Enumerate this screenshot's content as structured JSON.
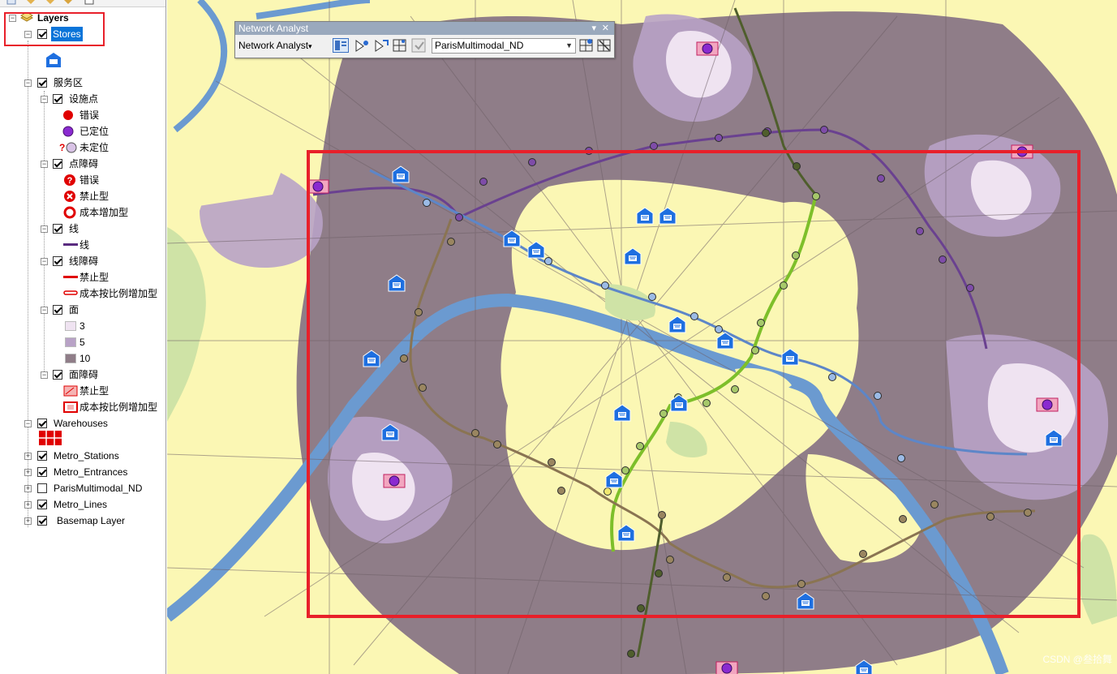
{
  "toc": {
    "root": "Layers",
    "stores": "Stores",
    "service_area": "服务区",
    "facilities": "设施点",
    "fac_error": "错误",
    "fac_located": "已定位",
    "fac_unlocated_mark": "?",
    "fac_unlocated": "未定位",
    "point_barriers": "点障碍",
    "pb_error": "错误",
    "pb_restriction": "禁止型",
    "pb_added_cost": "成本增加型",
    "lines": "线",
    "lines_item": "线",
    "line_barriers": "线障碍",
    "lb_restriction": "禁止型",
    "lb_scaled_cost": "成本按比例增加型",
    "polygons": "面",
    "poly_3": "3",
    "poly_5": "5",
    "poly_10": "10",
    "polygon_barriers": "面障碍",
    "pgb_restriction": "禁止型",
    "pgb_scaled_cost": "成本按比例增加型",
    "warehouses": "Warehouses",
    "metro_stations": "Metro_Stations",
    "metro_entrances": "Metro_Entrances",
    "paris_nd": "ParisMultimodal_ND",
    "metro_lines": "Metro_Lines",
    "basemap": "Basemap Layer"
  },
  "network_analyst": {
    "title": "Network Analyst",
    "menu": "Network Analyst",
    "menu_arrow": "▾",
    "pin": "▾",
    "close": "✕",
    "dataset": "ParisMultimodal_ND",
    "dataset_arrow": "▼"
  },
  "watermark": "CSDN @叁拾舞",
  "colors": {
    "selection": "#0a74d9",
    "highlight_box": "#e8202a",
    "store_icon": "#1e6fe0",
    "facility_located": "#8a2ad0",
    "facility_error": "#e00000",
    "area_3": "#efe3f1",
    "area_5": "#b8a2c6",
    "area_10": "#8f7d88",
    "map_background": "#fbf7b4",
    "river": "#6b9ad0",
    "park": "#cfe3a6"
  }
}
